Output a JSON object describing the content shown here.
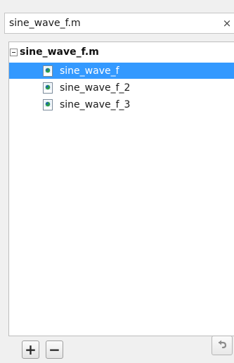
{
  "search": {
    "value": "sine_wave_f.m",
    "clear_symbol": "×"
  },
  "tree": {
    "root_label": "sine_wave_f.m",
    "items": [
      {
        "label": "sine_wave_f",
        "selected": true
      },
      {
        "label": "sine_wave_f_2",
        "selected": false
      },
      {
        "label": "sine_wave_f_3",
        "selected": false
      }
    ]
  },
  "toolbar": {
    "add_label": "+",
    "remove_label": "−"
  },
  "colors": {
    "selection": "#3399ff",
    "background": "#f0f0f0"
  },
  "icons": {
    "file": "model-file-icon",
    "undo": "undo-icon"
  }
}
